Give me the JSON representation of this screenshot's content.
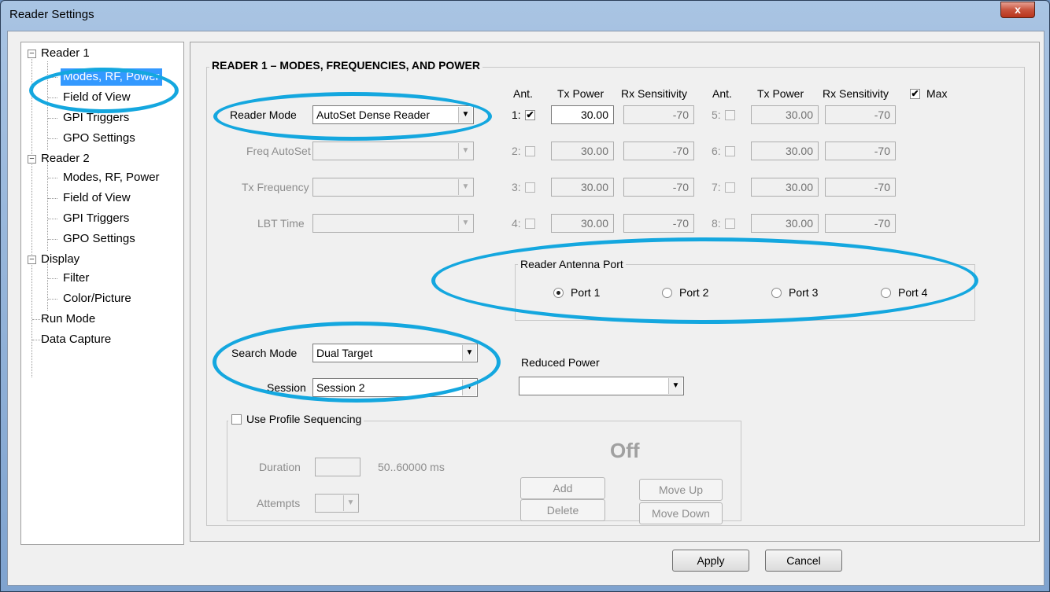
{
  "window": {
    "title": "Reader Settings",
    "close": "x"
  },
  "tree": {
    "reader1": "Reader 1",
    "r1_modes": "Modes, RF, Power",
    "r1_fov": "Field of View",
    "r1_gpi": "GPI Triggers",
    "r1_gpo": "GPO Settings",
    "reader2": "Reader 2",
    "r2_modes": "Modes, RF, Power",
    "r2_fov": "Field of View",
    "r2_gpi": "GPI Triggers",
    "r2_gpo": "GPO Settings",
    "display": "Display",
    "filter": "Filter",
    "color": "Color/Picture",
    "run_mode": "Run Mode",
    "data_capture": "Data Capture",
    "expand_symbol": "−"
  },
  "section_title": "READER 1 – MODES, FREQUENCIES, AND POWER",
  "reader_mode": {
    "label": "Reader Mode",
    "value": "AutoSet Dense Reader"
  },
  "freq_autoset": {
    "label": "Freq AutoSet",
    "value": ""
  },
  "tx_frequency": {
    "label": "Tx Frequency",
    "value": ""
  },
  "lbt_time": {
    "label": "LBT Time",
    "value": ""
  },
  "columns": {
    "ant": "Ant.",
    "tx": "Tx Power",
    "rx": "Rx Sensitivity",
    "max": "Max",
    "max_checked": "✔"
  },
  "antennas": [
    {
      "num": "1:",
      "tx": "30.00",
      "rx": "-70",
      "checked": "✔"
    },
    {
      "num": "2:",
      "tx": "30.00",
      "rx": "-70",
      "checked": ""
    },
    {
      "num": "3:",
      "tx": "30.00",
      "rx": "-70",
      "checked": ""
    },
    {
      "num": "4:",
      "tx": "30.00",
      "rx": "-70",
      "checked": ""
    },
    {
      "num": "5:",
      "tx": "30.00",
      "rx": "-70",
      "checked": ""
    },
    {
      "num": "6:",
      "tx": "30.00",
      "rx": "-70",
      "checked": ""
    },
    {
      "num": "7:",
      "tx": "30.00",
      "rx": "-70",
      "checked": ""
    },
    {
      "num": "8:",
      "tx": "30.00",
      "rx": "-70",
      "checked": ""
    }
  ],
  "antenna_port": {
    "title": "Reader Antenna Port",
    "ports": [
      "Port 1",
      "Port 2",
      "Port 3",
      "Port 4"
    ],
    "selected": "Port 1"
  },
  "search_mode": {
    "label": "Search Mode",
    "value": "Dual Target"
  },
  "session": {
    "label": "Session",
    "value": "Session 2"
  },
  "reduced_power": {
    "label": "Reduced Power",
    "value": ""
  },
  "profile": {
    "checkbox_label": "Use Profile Sequencing",
    "status": "Off",
    "duration_label": "Duration",
    "duration_value": "",
    "duration_range": "50..60000 ms",
    "attempts_label": "Attempts",
    "add": "Add",
    "delete": "Delete",
    "move_up": "Move Up",
    "move_down": "Move Down"
  },
  "footer": {
    "apply": "Apply",
    "cancel": "Cancel"
  },
  "colors": {
    "highlight_circle": "#14a7df",
    "selection": "#3399ff"
  }
}
